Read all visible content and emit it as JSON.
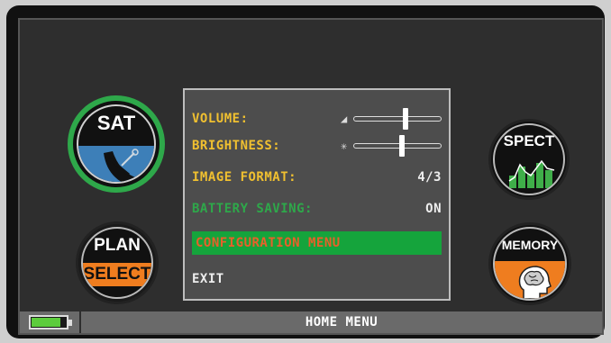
{
  "left_buttons": {
    "sat": {
      "label": "SAT",
      "icon": "satellite-dish-icon"
    },
    "plan": {
      "label_top": "PLAN",
      "label_bottom": "SELECT"
    }
  },
  "right_buttons": {
    "spect": {
      "label": "SPECT",
      "icon": "spectrum-bars-icon"
    },
    "memory": {
      "label": "MEMORY",
      "icon": "brain-head-icon"
    }
  },
  "menu": {
    "volume": {
      "label": "VOLUME:",
      "level": 0.6
    },
    "brightness": {
      "label": "BRIGHTNESS:",
      "level": 0.55
    },
    "image_format": {
      "label": "IMAGE FORMAT:",
      "value": "4/3"
    },
    "battery_saving": {
      "label": "BATTERY SAVING:",
      "value": "ON"
    },
    "configuration_menu": {
      "label": "CONFIGURATION MENU"
    },
    "exit": {
      "label": "EXIT"
    }
  },
  "status_bar": {
    "title": "HOME MENU",
    "battery_level": 0.85
  },
  "colors": {
    "accent_yellow": "#f0c030",
    "accent_green": "#15a43c",
    "accent_orange": "#ef7d1f",
    "sat_blue": "#3d7fb8"
  }
}
